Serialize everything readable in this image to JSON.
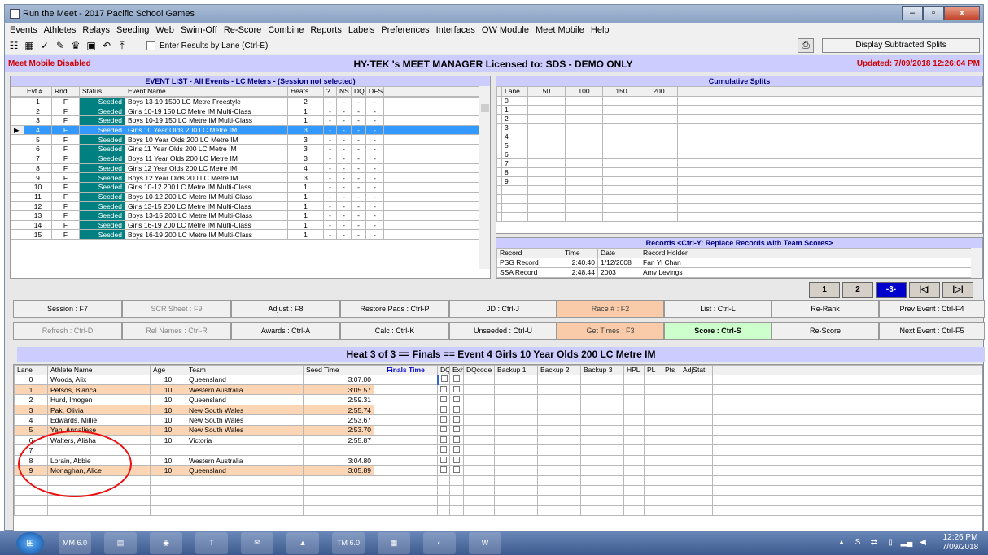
{
  "window": {
    "title": "Run the Meet - 2017 Pacific School Games",
    "minimize": "–",
    "maximize": "▫",
    "close": "x"
  },
  "menu": [
    "Events",
    "Athletes",
    "Relays",
    "Seeding",
    "Web",
    "Swim-Off",
    "Re-Score",
    "Combine",
    "Reports",
    "Labels",
    "Preferences",
    "Interfaces",
    "OW Module",
    "Meet Mobile",
    "Help"
  ],
  "toolbar": {
    "enter_by_lane": "Enter Results by Lane (Ctrl-E)",
    "display_splits": "Display Subtracted Splits"
  },
  "status": {
    "left": "Meet Mobile Disabled",
    "center": "HY-TEK 's MEET MANAGER Licensed to:  SDS - DEMO ONLY",
    "right": "Updated: 7/09/2018 12:26:04 PM"
  },
  "event_list": {
    "title": "EVENT LIST - All Events - LC Meters - (Session not selected)",
    "headers": [
      "Evt #",
      "Rnd",
      "Status",
      "Event Name",
      "Heats",
      "?",
      "NS",
      "DQ",
      "DFS"
    ],
    "rows": [
      [
        "1",
        "F",
        "Seeded",
        "Boys 13-19 1500 LC Metre Freestyle",
        "2",
        "-",
        "-",
        "-",
        "-"
      ],
      [
        "2",
        "F",
        "Seeded",
        "Girls 10-19 150 LC Metre IM Multi-Class",
        "1",
        "-",
        "-",
        "-",
        "-"
      ],
      [
        "3",
        "F",
        "Seeded",
        "Boys 10-19 150 LC Metre IM Multi-Class",
        "1",
        "-",
        "-",
        "-",
        "-"
      ],
      [
        "4",
        "F",
        "Seeded",
        "Girls 10 Year Olds 200 LC Metre IM",
        "3",
        "-",
        "-",
        "-",
        "-"
      ],
      [
        "5",
        "F",
        "Seeded",
        "Boys 10 Year Olds 200 LC Metre IM",
        "3",
        "-",
        "-",
        "-",
        "-"
      ],
      [
        "6",
        "F",
        "Seeded",
        "Girls 11 Year Olds 200 LC Metre IM",
        "3",
        "-",
        "-",
        "-",
        "-"
      ],
      [
        "7",
        "F",
        "Seeded",
        "Boys 11 Year Olds 200 LC Metre IM",
        "3",
        "-",
        "-",
        "-",
        "-"
      ],
      [
        "8",
        "F",
        "Seeded",
        "Girls 12 Year Olds 200 LC Metre IM",
        "4",
        "-",
        "-",
        "-",
        "-"
      ],
      [
        "9",
        "F",
        "Seeded",
        "Boys 12 Year Olds 200 LC Metre IM",
        "3",
        "-",
        "-",
        "-",
        "-"
      ],
      [
        "10",
        "F",
        "Seeded",
        "Girls 10-12 200 LC Metre IM Multi-Class",
        "1",
        "-",
        "-",
        "-",
        "-"
      ],
      [
        "11",
        "F",
        "Seeded",
        "Boys 10-12 200 LC Metre IM Multi-Class",
        "1",
        "-",
        "-",
        "-",
        "-"
      ],
      [
        "12",
        "F",
        "Seeded",
        "Girls 13-15 200 LC Metre IM Multi-Class",
        "1",
        "-",
        "-",
        "-",
        "-"
      ],
      [
        "13",
        "F",
        "Seeded",
        "Boys 13-15 200 LC Metre IM Multi-Class",
        "1",
        "-",
        "-",
        "-",
        "-"
      ],
      [
        "14",
        "F",
        "Seeded",
        "Girls 16-19 200 LC Metre IM Multi-Class",
        "1",
        "-",
        "-",
        "-",
        "-"
      ],
      [
        "15",
        "F",
        "Seeded",
        "Boys 16-19 200 LC Metre IM Multi-Class",
        "1",
        "-",
        "-",
        "-",
        "-"
      ]
    ]
  },
  "splits": {
    "title": "Cumulative Splits",
    "headers": [
      "Lane",
      "50",
      "100",
      "150",
      "200"
    ],
    "lanes": [
      "0",
      "1",
      "2",
      "3",
      "4",
      "5",
      "6",
      "7",
      "8",
      "9"
    ]
  },
  "records": {
    "title": "Records   <Ctrl-Y: Replace Records with Team Scores>",
    "headers": [
      "Record",
      "Time",
      "Date",
      "Record Holder"
    ],
    "rows": [
      [
        "PSG Record",
        "2:40.40",
        "1/12/2008",
        "Fan Yi Chan"
      ],
      [
        "SSA Record",
        "2:48.44",
        "2003",
        "Amy Levings"
      ]
    ]
  },
  "heat_pages": [
    "1",
    "2",
    "-3-"
  ],
  "buttons_row1": [
    "Session : F7",
    "SCR Sheet : F9",
    "Adjust : F8",
    "Restore Pads : Ctrl-P",
    "JD : Ctrl-J",
    "Race # : F2",
    "List : Ctrl-L",
    "Re-Rank",
    "Prev Event : Ctrl-F4"
  ],
  "buttons_row2": [
    "Refresh : Ctrl-D",
    "Rel Names : Ctrl-R",
    "Awards : Ctrl-A",
    "Calc : Ctrl-K",
    "Unseeded : Ctrl-U",
    "Get Times : F3",
    "Score : Ctrl-S",
    "Re-Score",
    "Next Event : Ctrl-F5"
  ],
  "heat_title": "Heat  3  of  3  ==  Finals  ==  Event 4  Girls 10 Year Olds 200 LC Metre IM",
  "lanes": {
    "headers": [
      "Lane",
      "Athlete Name",
      "Age",
      "Team",
      "Seed Time",
      "Finals Time",
      "DQ",
      "Exh",
      "DQcode",
      "Backup 1",
      "Backup 2",
      "Backup 3",
      "HPL",
      "PL",
      "Pts",
      "AdjStat"
    ],
    "rows": [
      {
        "lane": "0",
        "name": "Woods, Alix",
        "age": "10",
        "team": "Queensland",
        "seed": "3:07.00"
      },
      {
        "lane": "1",
        "name": "Petsos, Bianca",
        "age": "10",
        "team": "Western Australia",
        "seed": "3:05.57"
      },
      {
        "lane": "2",
        "name": "Hurd, Imogen",
        "age": "10",
        "team": "Queensland",
        "seed": "2:59.31"
      },
      {
        "lane": "3",
        "name": "Pak, Olivia",
        "age": "10",
        "team": "New South Wales",
        "seed": "2:55.74"
      },
      {
        "lane": "4",
        "name": "Edwards, Millie",
        "age": "10",
        "team": "New South Wales",
        "seed": "2:53.67"
      },
      {
        "lane": "5",
        "name": "Yan, Annaliese",
        "age": "10",
        "team": "New South Wales",
        "seed": "2:53.70"
      },
      {
        "lane": "6",
        "name": "Walters, Alisha",
        "age": "10",
        "team": "Victoria",
        "seed": "2:55.87"
      },
      {
        "lane": "7",
        "name": "",
        "age": "",
        "team": "",
        "seed": ""
      },
      {
        "lane": "8",
        "name": "Lorain, Abbie",
        "age": "10",
        "team": "Western Australia",
        "seed": "3:04.80"
      },
      {
        "lane": "9",
        "name": "Monaghan, Alice",
        "age": "10",
        "team": "Queensland",
        "seed": "3:05.89"
      }
    ]
  },
  "taskbar": {
    "time": "12:26 PM",
    "date": "7/09/2018",
    "apps": [
      "MM 6.0",
      "Explorer",
      "Firefox",
      "Telstra",
      "Outlook",
      "VLC",
      "TM 6.0",
      "Calculator",
      "Media",
      "Word"
    ]
  }
}
